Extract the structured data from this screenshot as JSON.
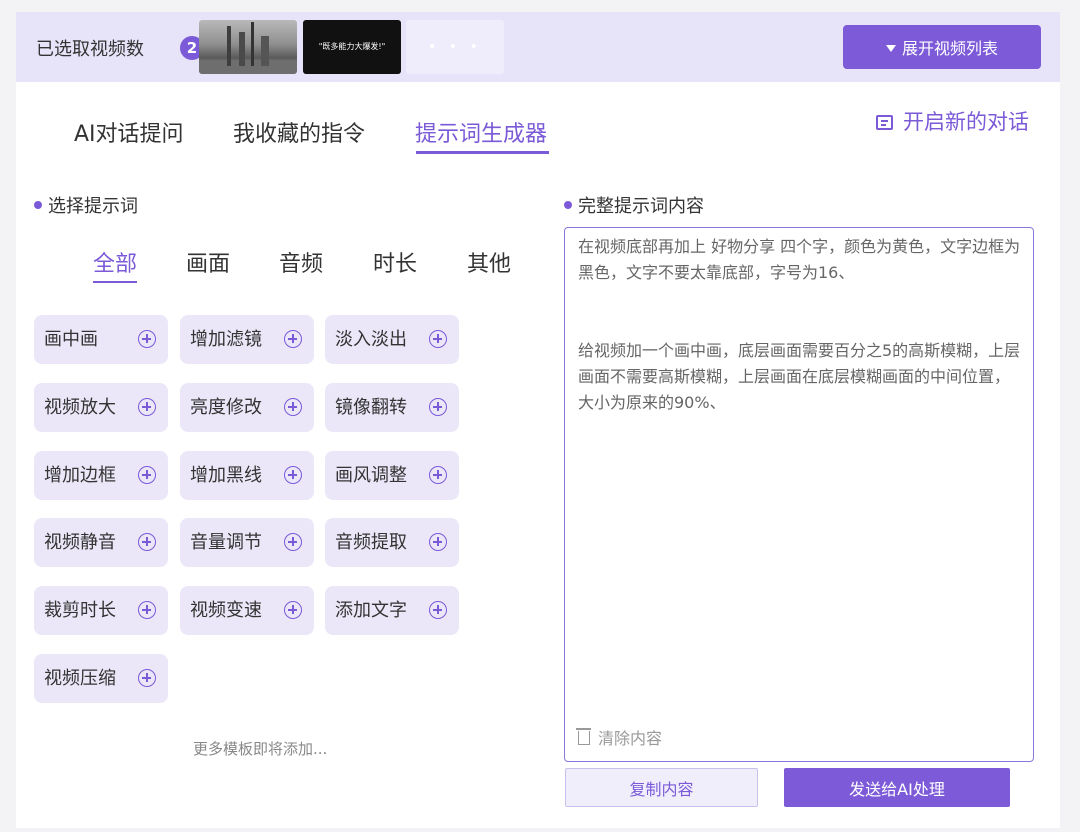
{
  "header": {
    "selected_label": "已选取视频数",
    "selected_count": "2",
    "thumb2_caption": "\"既多能力大爆发!\"",
    "thumb3_more": "• • •",
    "expand_button": "展开视频列表"
  },
  "tabs": [
    {
      "label": "AI对话提问",
      "active": false
    },
    {
      "label": "我收藏的指令",
      "active": false
    },
    {
      "label": "提示词生成器",
      "active": true
    }
  ],
  "new_chat": "开启新的对话",
  "left": {
    "title": "选择提示词",
    "categories": [
      "全部",
      "画面",
      "音频",
      "时长",
      "其他"
    ],
    "active_category": "全部",
    "chips": [
      "画中画",
      "增加滤镜",
      "淡入淡出",
      "视频放大",
      "亮度修改",
      "镜像翻转",
      "增加边框",
      "增加黑线",
      "画风调整",
      "视频静音",
      "音量调节",
      "音频提取",
      "裁剪时长",
      "视频变速",
      "添加文字",
      "视频压缩"
    ],
    "more_text": "更多模板即将添加..."
  },
  "right": {
    "title": "完整提示词内容",
    "paragraph1": "在视频底部再加上 好物分享 四个字，颜色为黄色，文字边框为黑色，文字不要太靠底部，字号为16、",
    "paragraph2": "给视频加一个画中画，底层画面需要百分之5的高斯模糊，上层画面不需要高斯模糊，上层画面在底层模糊画面的中间位置，大小为原来的90%、",
    "clear_label": "清除内容",
    "copy_button": "复制内容",
    "send_button": "发送给AI处理"
  },
  "colors": {
    "accent": "#7b5ad8",
    "chip_bg": "#ebe7f8",
    "topbar_bg": "#e7e4f9"
  }
}
